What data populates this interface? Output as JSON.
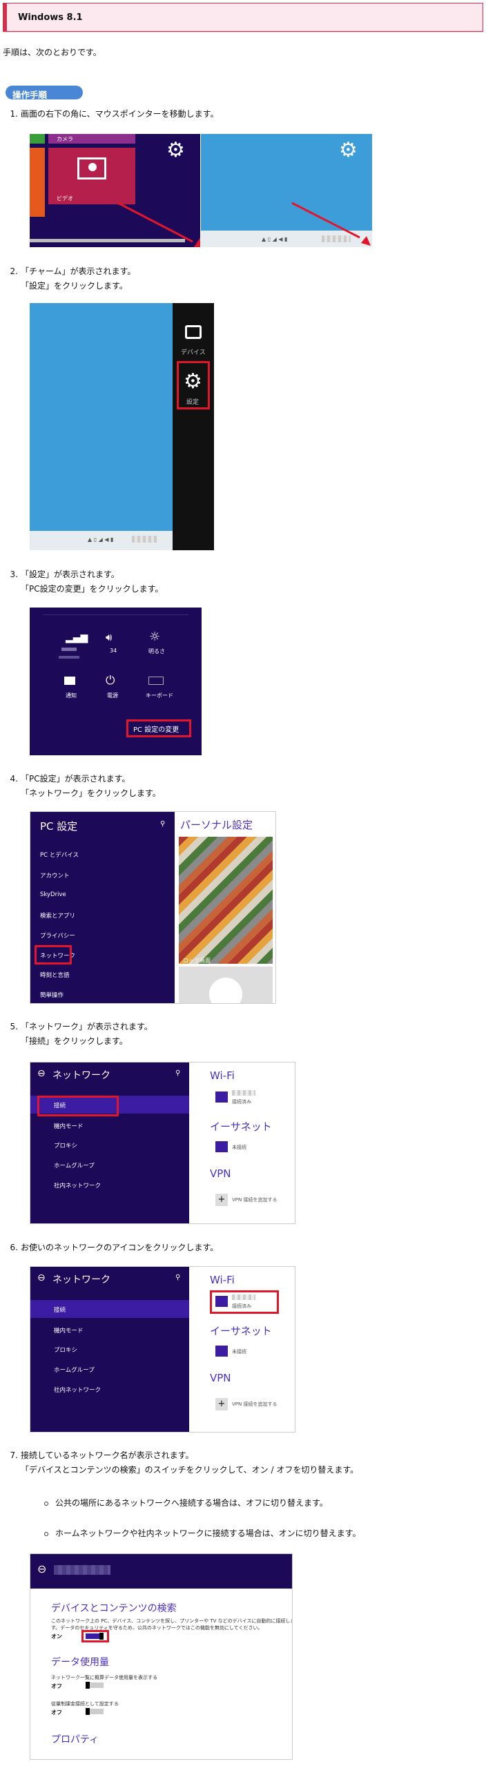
{
  "header": {
    "title": "Windows 8.1"
  },
  "intro": "手順は、次のとおりです。",
  "section_badge": "操作手順",
  "steps": [
    {
      "num": "1.",
      "lines": [
        "画面の右下の角に、マウスポインターを移動します。"
      ]
    },
    {
      "num": "2.",
      "lines": [
        "「チャーム」が表示されます。",
        "「設定」をクリックします。"
      ]
    },
    {
      "num": "3.",
      "lines": [
        "「設定」が表示されます。",
        "「PC設定の変更」をクリックします。"
      ]
    },
    {
      "num": "4.",
      "lines": [
        "「PC設定」が表示されます。",
        "「ネットワーク」をクリックします。"
      ]
    },
    {
      "num": "5.",
      "lines": [
        "「ネットワーク」が表示されます。",
        "「接続」をクリックします。"
      ]
    },
    {
      "num": "6.",
      "lines": [
        "お使いのネットワークのアイコンをクリックします。"
      ]
    },
    {
      "num": "7.",
      "lines": [
        "接続しているネットワーク名が表示されます。",
        "「デバイスとコンテンツの検索」のスイッチをクリックして、オン / オフを切り替えます。"
      ]
    }
  ],
  "bullets": [
    "公共の場所にあるネットワークへ接続する場合は、オフに切り替えます。",
    "ホームネットワークや社内ネットワークに接続する場合は、オンに切り替えます。"
  ],
  "shot1": {
    "tile1": "カメラ",
    "tile2": "ビデオ"
  },
  "shot2": {
    "devices": "デバイス",
    "settings": "設定"
  },
  "shot3": {
    "volume": "34",
    "brightness": "明るさ",
    "notify": "通知",
    "power": "電源",
    "keyboard": "キーボード",
    "pc_settings": "PC 設定の変更"
  },
  "shot4": {
    "title": "PC 設定",
    "menu": [
      "PC とデバイス",
      "アカウント",
      "SkyDrive",
      "検索とアプリ",
      "プライバシー",
      "ネットワーク",
      "時刻と言語",
      "簡単操作"
    ],
    "right_title": "パーソナル設定",
    "lock_label": "ロック画面"
  },
  "network_panel": {
    "title": "ネットワーク",
    "menu": [
      "接続",
      "機内モード",
      "プロキシ",
      "ホームグループ",
      "社内ネットワーク"
    ],
    "wifi": "Wi-Fi",
    "connected": "接続済み",
    "ethernet": "イーサネット",
    "unconnected": "未接続",
    "vpn": "VPN",
    "vpn_add": "VPN 接続を追加する"
  },
  "shot7": {
    "section1": "デバイスとコンテンツの検索",
    "desc1": "このネットワーク上の PC、デバイス、コンテンツを探し、プリンターや TV などのデバイスに自動的に接続しま",
    "desc2": "す。データのセキュリティを守るため、公共のネットワークではこの機能を無効にしてください。",
    "on": "オン",
    "section2": "データ使用量",
    "usage1": "ネットワーク一覧に概算データ使用量を表示する",
    "off1": "オフ",
    "usage2": "従量制課金接続として設定する",
    "off2": "オフ",
    "section3": "プロパティ"
  },
  "colors": {
    "accent_red": "#e2162a",
    "win_purple": "#1c0a59",
    "win_blue": "#3c9dd8",
    "badge_blue": "#4a86d6"
  }
}
